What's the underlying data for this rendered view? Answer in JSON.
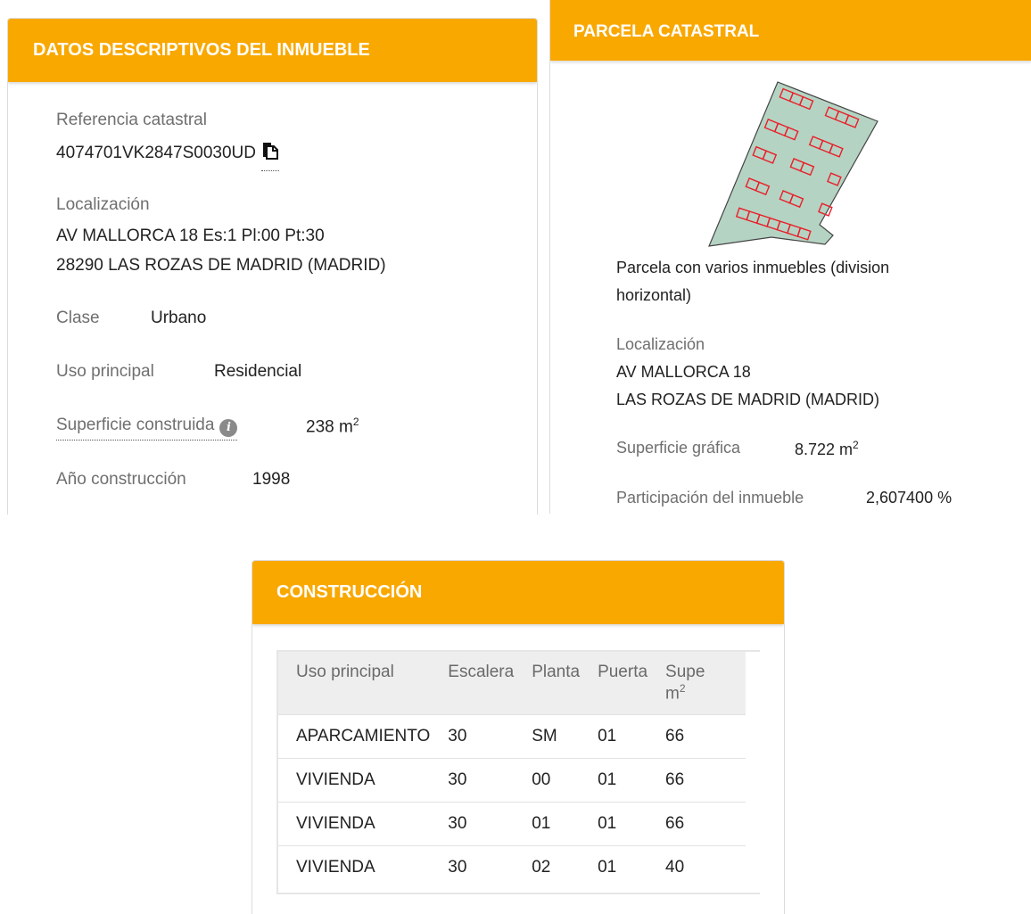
{
  "descriptive": {
    "title": "DATOS DESCRIPTIVOS DEL INMUEBLE",
    "ref_label": "Referencia catastral",
    "ref_value": "4074701VK2847S0030UD",
    "loc_label": "Localización",
    "loc_line1": "AV MALLORCA 18 Es:1 Pl:00 Pt:30",
    "loc_line2": "28290 LAS ROZAS DE MADRID (MADRID)",
    "clase_label": "Clase",
    "clase_value": "Urbano",
    "uso_label": "Uso principal",
    "uso_value": "Residencial",
    "sup_label": "Superficie construida",
    "sup_value": "238 m",
    "sup_exp": "2",
    "anio_label": "Año construcción",
    "anio_value": "1998"
  },
  "parcel": {
    "title": "PARCELA CATASTRAL",
    "desc_line1": "Parcela con varios inmuebles (division",
    "desc_line2": "horizontal)",
    "loc_label": "Localización",
    "loc_line1": "AV MALLORCA 18",
    "loc_line2": "LAS ROZAS DE MADRID (MADRID)",
    "sup_label": "Superficie gráfica",
    "sup_value": "8.722 m",
    "sup_exp": "2",
    "part_label": "Participación del inmueble",
    "part_value": "2,607400 %"
  },
  "construction": {
    "title": "CONSTRUCCIÓN",
    "headers": [
      "Uso principal",
      "Escalera",
      "Planta",
      "Puerta",
      "Supe"
    ],
    "header_unit": "m",
    "header_unit_exp": "2",
    "rows": [
      [
        "APARCAMIENTO",
        "30",
        "SM",
        "01",
        "66"
      ],
      [
        "VIVIENDA",
        "30",
        "00",
        "01",
        "66"
      ],
      [
        "VIVIENDA",
        "30",
        "01",
        "01",
        "66"
      ],
      [
        "VIVIENDA",
        "30",
        "02",
        "01",
        "40"
      ]
    ]
  },
  "colors": {
    "header": "#f9a800",
    "parcel_fill": "#b5d3c3",
    "building_outline": "#e8202a"
  },
  "icons": {
    "copy": "copy-icon",
    "info": "info-icon"
  }
}
